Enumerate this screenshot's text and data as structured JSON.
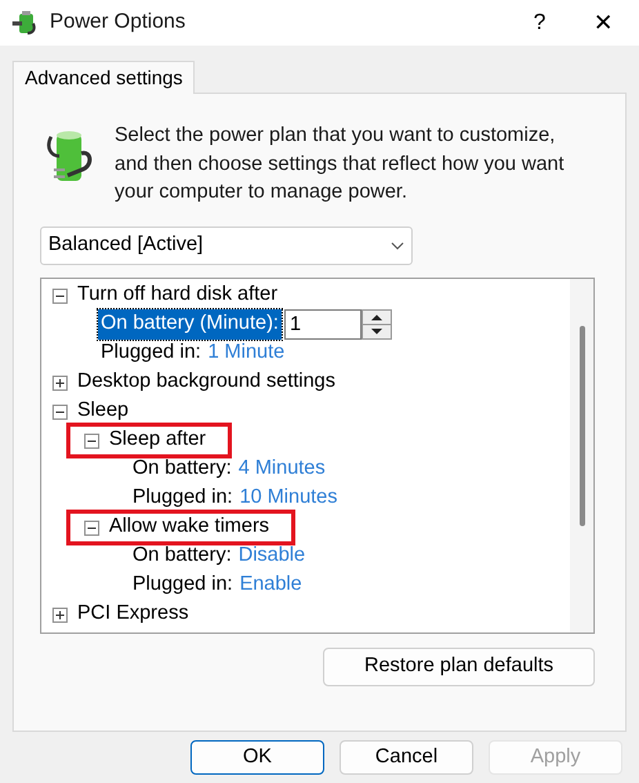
{
  "window": {
    "title": "Power Options",
    "help": "?",
    "close": "✕"
  },
  "tabs": [
    {
      "label": "Advanced settings",
      "selected": true
    }
  ],
  "description": "Select the power plan that you want to customize, and then choose settings that reflect how you want your computer to manage power.",
  "plan_select": {
    "value": "Balanced [Active]"
  },
  "tree": {
    "items": [
      {
        "kind": "group",
        "children": [
          {
            "kind": "group",
            "label": "Turn off hard disk after",
            "expanded": true,
            "highlighted": false,
            "children": [
              {
                "kind": "setting",
                "label": "On battery (Minute):",
                "value": "1",
                "editing": true
              },
              {
                "kind": "setting",
                "label": "Plugged in:",
                "value": "1 Minute",
                "editing": false
              }
            ]
          }
        ]
      },
      {
        "kind": "group",
        "label": "Desktop background settings",
        "expanded": false,
        "highlighted": false
      },
      {
        "kind": "group",
        "label": "Sleep",
        "expanded": true,
        "highlighted": false,
        "children": [
          {
            "kind": "group",
            "label": "Sleep after",
            "expanded": true,
            "highlighted": true,
            "children": [
              {
                "kind": "setting",
                "label": "On battery:",
                "value": "4 Minutes",
                "editing": false
              },
              {
                "kind": "setting",
                "label": "Plugged in:",
                "value": "10 Minutes",
                "editing": false
              }
            ]
          },
          {
            "kind": "group",
            "label": "Allow wake timers",
            "expanded": true,
            "highlighted": true,
            "children": [
              {
                "kind": "setting",
                "label": "On battery:",
                "value": "Disable",
                "editing": false
              },
              {
                "kind": "setting",
                "label": "Plugged in:",
                "value": "Enable",
                "editing": false
              }
            ]
          }
        ]
      },
      {
        "kind": "group",
        "label": "PCI Express",
        "expanded": false,
        "highlighted": false
      }
    ]
  },
  "restore_button": "Restore plan defaults",
  "buttons": [
    {
      "label": "OK",
      "kind": "default",
      "disabled": false
    },
    {
      "label": "Cancel",
      "kind": "normal",
      "disabled": false
    },
    {
      "label": "Apply",
      "kind": "normal",
      "disabled": true
    }
  ]
}
